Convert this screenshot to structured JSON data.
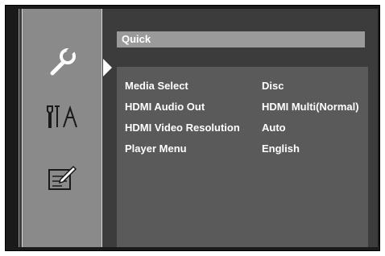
{
  "menu": {
    "header": "Quick",
    "icons": [
      "wrench-icon",
      "tools-icon",
      "edit-icon"
    ],
    "items": [
      {
        "label": "Media Select",
        "value": "Disc"
      },
      {
        "label": "HDMI Audio Out",
        "value": "HDMI Multi(Normal)"
      },
      {
        "label": "HDMI Video Resolution",
        "value": "Auto"
      },
      {
        "label": "Player Menu",
        "value": "English"
      }
    ]
  }
}
